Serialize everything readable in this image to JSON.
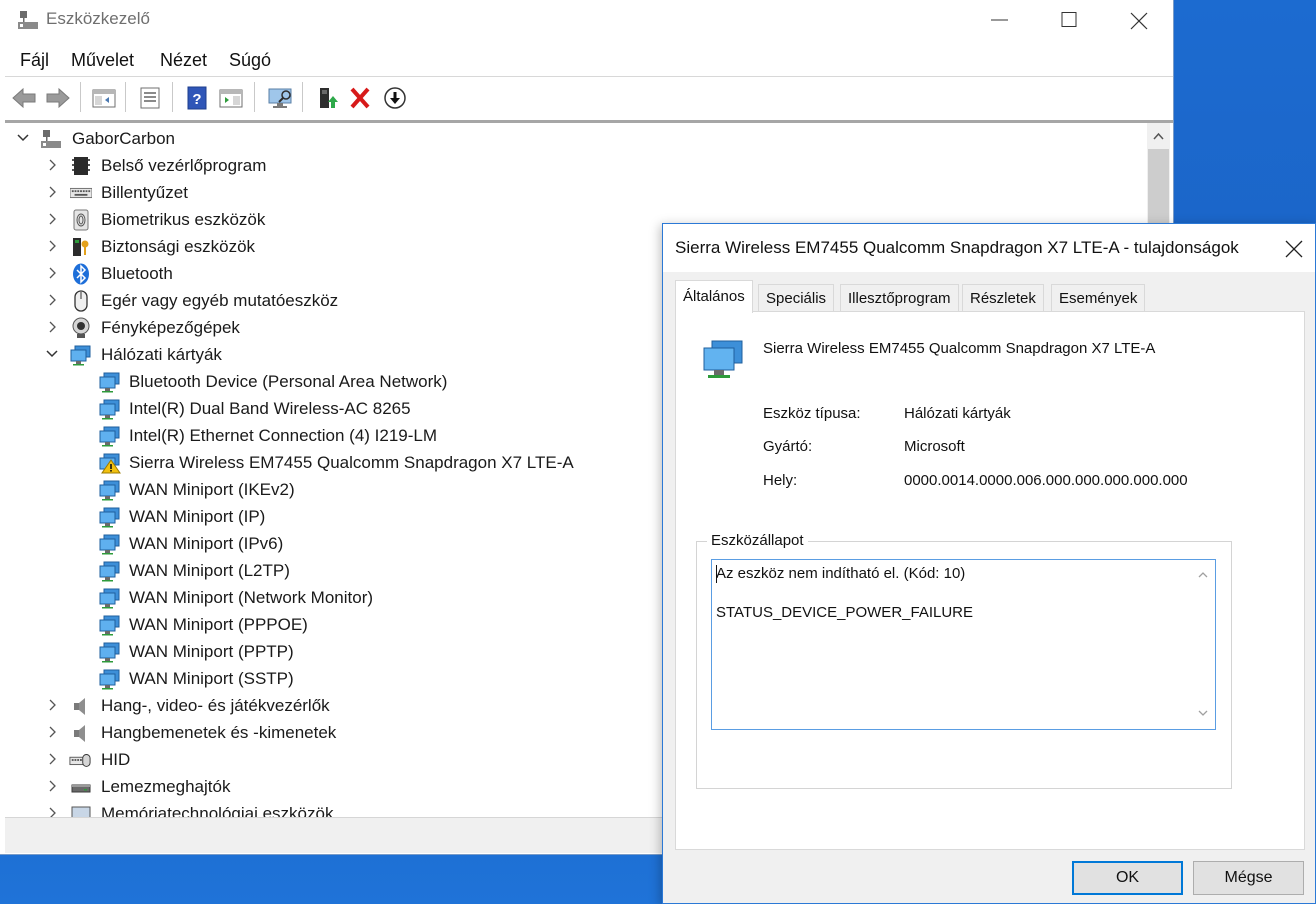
{
  "window": {
    "title": "Eszközkezelő"
  },
  "menu": [
    "Fájl",
    "Művelet",
    "Nézet",
    "Súgó"
  ],
  "toolbar": {
    "icons": [
      "back-arrow-icon",
      "forward-arrow-icon",
      "show-hide-console-tree-icon",
      "properties-icon",
      "help-icon",
      "action-pane-icon",
      "scan-hardware-icon",
      "update-driver-icon",
      "uninstall-device-icon",
      "disable-device-icon"
    ]
  },
  "tree": {
    "root": "GaborCarbon",
    "categories": [
      {
        "label": "Belső vezérlőprogram",
        "icon": "firmware-chip-icon"
      },
      {
        "label": "Billentyűzet",
        "icon": "keyboard-icon"
      },
      {
        "label": "Biometrikus eszközök",
        "icon": "fingerprint-icon"
      },
      {
        "label": "Biztonsági eszközök",
        "icon": "security-key-icon"
      },
      {
        "label": "Bluetooth",
        "icon": "bluetooth-icon"
      },
      {
        "label": "Egér vagy egyéb mutatóeszköz",
        "icon": "mouse-icon"
      },
      {
        "label": "Fényképezőgépek",
        "icon": "camera-icon"
      },
      {
        "label": "Hálózati kártyák",
        "icon": "network-adapter-icon",
        "expanded": true
      }
    ],
    "network_adapters": [
      {
        "label": "Bluetooth Device (Personal Area Network)",
        "warning": false
      },
      {
        "label": "Intel(R) Dual Band Wireless-AC 8265",
        "warning": false
      },
      {
        "label": "Intel(R) Ethernet Connection (4) I219-LM",
        "warning": false
      },
      {
        "label": "Sierra Wireless EM7455 Qualcomm Snapdragon X7 LTE-A",
        "warning": true
      },
      {
        "label": "WAN Miniport (IKEv2)",
        "warning": false
      },
      {
        "label": "WAN Miniport (IP)",
        "warning": false
      },
      {
        "label": "WAN Miniport (IPv6)",
        "warning": false
      },
      {
        "label": "WAN Miniport (L2TP)",
        "warning": false
      },
      {
        "label": "WAN Miniport (Network Monitor)",
        "warning": false
      },
      {
        "label": "WAN Miniport (PPPOE)",
        "warning": false
      },
      {
        "label": "WAN Miniport (PPTP)",
        "warning": false
      },
      {
        "label": "WAN Miniport (SSTP)",
        "warning": false
      }
    ],
    "categories_after": [
      {
        "label": "Hang-, video- és játékvezérlők",
        "icon": "speaker-icon"
      },
      {
        "label": "Hangbemenetek és -kimenetek",
        "icon": "speaker-icon"
      },
      {
        "label": "HID",
        "icon": "hid-icon"
      },
      {
        "label": "Lemezmeghajtók",
        "icon": "disk-drive-icon"
      },
      {
        "label": "Memóriatechnológiai eszközök",
        "icon": "memory-device-icon"
      }
    ]
  },
  "dialog": {
    "title": "Sierra Wireless EM7455 Qualcomm Snapdragon X7 LTE-A - tulajdonságok",
    "tabs": [
      "Általános",
      "Speciális",
      "Illesztőprogram",
      "Részletek",
      "Események"
    ],
    "active_tab": "Általános",
    "device_name": "Sierra Wireless EM7455 Qualcomm Snapdragon X7 LTE-A",
    "props": [
      {
        "label": "Eszköz típusa:",
        "value": "Hálózati kártyák"
      },
      {
        "label": "Gyártó:",
        "value": "Microsoft"
      },
      {
        "label": "Hely:",
        "value": "0000.0014.0000.006.000.000.000.000.000"
      }
    ],
    "status_group_label": "Eszközállapot",
    "status_lines": [
      "Az eszköz nem indítható el. (Kód: 10)",
      "STATUS_DEVICE_POWER_FAILURE"
    ],
    "ok_label": "OK",
    "cancel_label": "Mégse"
  }
}
